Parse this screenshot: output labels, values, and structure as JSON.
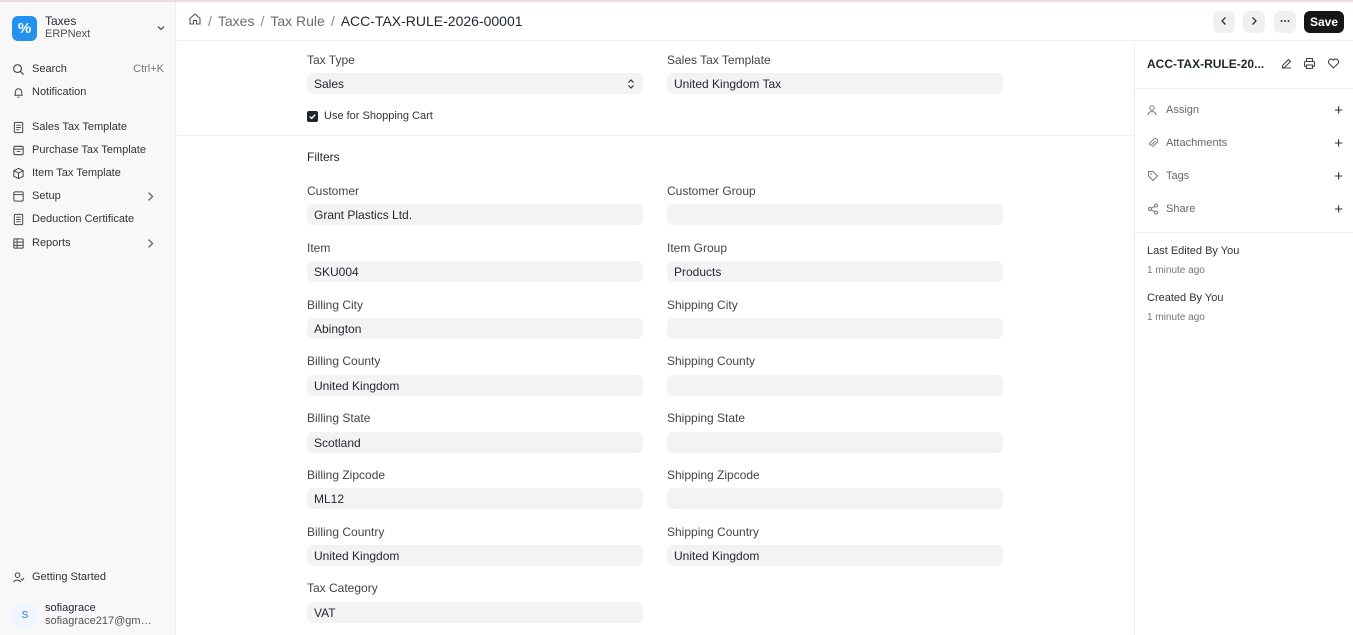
{
  "app": {
    "name": "Taxes",
    "subtitle": "ERPNext",
    "logo_glyph": "%"
  },
  "sidebar": {
    "search": {
      "label": "Search",
      "shortcut": "Ctrl+K"
    },
    "notification": "Notification",
    "items": [
      {
        "label": "Sales Tax Template",
        "icon": "doc-icon"
      },
      {
        "label": "Purchase Tax Template",
        "icon": "doc-icon"
      },
      {
        "label": "Item Tax Template",
        "icon": "box-icon"
      },
      {
        "label": "Setup",
        "icon": "folder-icon",
        "has_children": true
      },
      {
        "label": "Deduction Certificate",
        "icon": "doc-icon"
      },
      {
        "label": "Reports",
        "icon": "table-icon",
        "has_children": true
      }
    ],
    "getting_started": "Getting Started",
    "user": {
      "initial": "S",
      "name": "sofiagrace",
      "email": "sofiagrace217@gmai..."
    }
  },
  "header": {
    "breadcrumbs": [
      "Taxes",
      "Tax Rule"
    ],
    "current": "ACC-TAX-RULE-2026-00001",
    "save_label": "Save"
  },
  "form": {
    "tax_type": {
      "label": "Tax Type",
      "value": "Sales"
    },
    "sales_tax_template": {
      "label": "Sales Tax Template",
      "value": "United Kingdom Tax"
    },
    "use_for_shopping_cart": {
      "label": "Use for Shopping Cart",
      "checked": true
    },
    "filters_title": "Filters",
    "customer": {
      "label": "Customer",
      "value": "Grant Plastics Ltd."
    },
    "customer_group": {
      "label": "Customer Group",
      "value": ""
    },
    "item": {
      "label": "Item",
      "value": "SKU004"
    },
    "item_group": {
      "label": "Item Group",
      "value": "Products"
    },
    "billing_city": {
      "label": "Billing City",
      "value": "Abington"
    },
    "shipping_city": {
      "label": "Shipping City",
      "value": ""
    },
    "billing_county": {
      "label": "Billing County",
      "value": "United Kingdom"
    },
    "shipping_county": {
      "label": "Shipping County",
      "value": ""
    },
    "billing_state": {
      "label": "Billing State",
      "value": "Scotland"
    },
    "shipping_state": {
      "label": "Shipping State",
      "value": ""
    },
    "billing_zipcode": {
      "label": "Billing Zipcode",
      "value": "ML12"
    },
    "shipping_zipcode": {
      "label": "Shipping Zipcode",
      "value": ""
    },
    "billing_country": {
      "label": "Billing Country",
      "value": "United Kingdom"
    },
    "shipping_country": {
      "label": "Shipping Country",
      "value": "United Kingdom"
    },
    "tax_category": {
      "label": "Tax Category",
      "value": "VAT"
    }
  },
  "right_panel": {
    "title": "ACC-TAX-RULE-20...",
    "actions": [
      {
        "label": "Assign",
        "icon": "user-icon"
      },
      {
        "label": "Attachments",
        "icon": "paperclip-icon"
      },
      {
        "label": "Tags",
        "icon": "tag-icon"
      },
      {
        "label": "Share",
        "icon": "share-icon"
      }
    ],
    "last_edited": {
      "label": "Last Edited By You",
      "time": "1 minute ago"
    },
    "created": {
      "label": "Created By You",
      "time": "1 minute ago"
    }
  }
}
